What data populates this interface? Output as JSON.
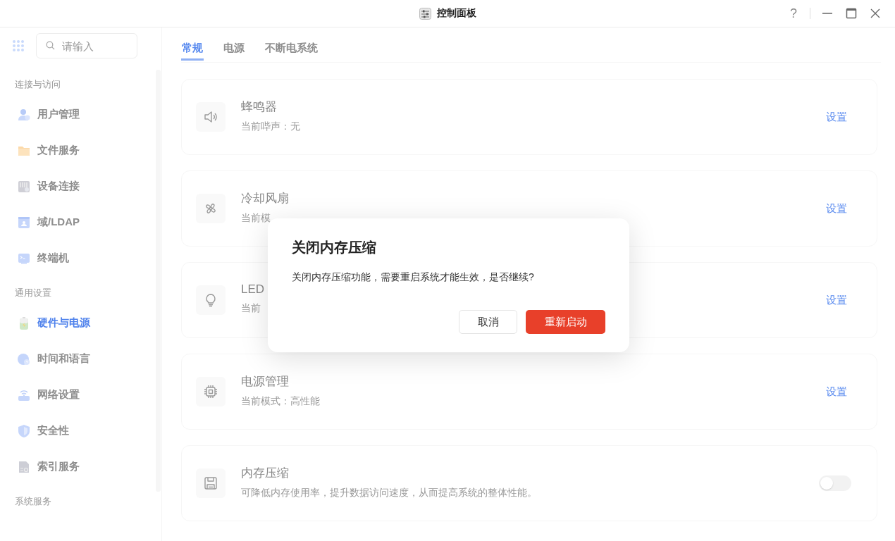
{
  "window": {
    "title": "控制面板",
    "help": "?"
  },
  "sidebar": {
    "search": {
      "placeholder": "请输入"
    },
    "sections": [
      {
        "title": "连接与访问",
        "items": [
          {
            "label": "用户管理",
            "selected": false
          },
          {
            "label": "文件服务",
            "selected": false
          },
          {
            "label": "设备连接",
            "selected": false
          },
          {
            "label": "域/LDAP",
            "selected": false
          },
          {
            "label": "终端机",
            "selected": false
          }
        ]
      },
      {
        "title": "通用设置",
        "items": [
          {
            "label": "硬件与电源",
            "selected": true
          },
          {
            "label": "时间和语言",
            "selected": false
          },
          {
            "label": "网络设置",
            "selected": false
          },
          {
            "label": "安全性",
            "selected": false
          },
          {
            "label": "索引服务",
            "selected": false
          }
        ]
      },
      {
        "title": "系统服务"
      }
    ]
  },
  "tabs": [
    {
      "label": "常规",
      "selected": true
    },
    {
      "label": "电源",
      "selected": false
    },
    {
      "label": "不断电系统",
      "selected": false
    }
  ],
  "cards": [
    {
      "kind": "link",
      "title": "蜂鸣器",
      "subtitle": "当前哔声：无",
      "action": "设置"
    },
    {
      "kind": "link",
      "title": "冷却风扇",
      "subtitle": "当前模",
      "action": "设置"
    },
    {
      "kind": "link",
      "title": "LED",
      "subtitle": "当前",
      "action": "设置"
    },
    {
      "kind": "link",
      "title": "电源管理",
      "subtitle": "当前模式：高性能",
      "action": "设置"
    },
    {
      "kind": "toggle",
      "title": "内存压缩",
      "subtitle": "可降低内存使用率，提升数据访问速度，从而提高系统的整体性能。",
      "on": false
    }
  ],
  "dialog": {
    "title": "关闭内存压缩",
    "message": "关闭内存压缩功能，需要重启系统才能生效，是否继续?",
    "buttons": [
      {
        "kind": "secondary",
        "label": "取消"
      },
      {
        "kind": "primary",
        "label": "重新启动"
      }
    ]
  }
}
